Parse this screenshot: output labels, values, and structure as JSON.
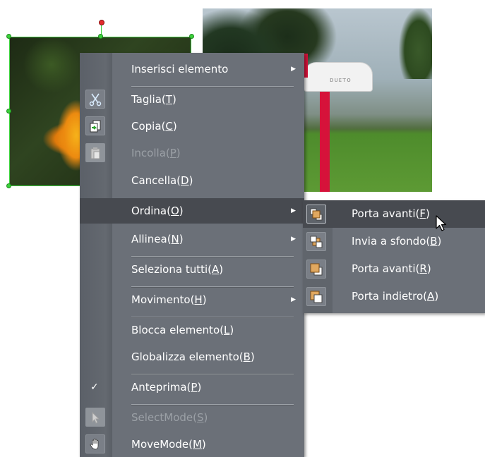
{
  "menu": {
    "items": [
      {
        "pre": "Inserisci elemento",
        "key": "",
        "post": "",
        "submenu": true,
        "disabled": false
      },
      {
        "pre": "Taglia(",
        "key": "T",
        "post": ")",
        "submenu": false,
        "disabled": false,
        "icon": "scissors-icon"
      },
      {
        "pre": "Copia(",
        "key": "C",
        "post": ")",
        "submenu": false,
        "disabled": false,
        "icon": "copy-icon"
      },
      {
        "pre": "Incolla(",
        "key": "P",
        "post": ")",
        "submenu": false,
        "disabled": true,
        "icon": "paste-icon"
      },
      {
        "pre": "Cancella(",
        "key": "D",
        "post": ")",
        "submenu": false,
        "disabled": false
      },
      {
        "pre": "Ordina(",
        "key": "O",
        "post": ")",
        "submenu": true,
        "disabled": false,
        "active": true
      },
      {
        "pre": "Allinea(",
        "key": "N",
        "post": ")",
        "submenu": true,
        "disabled": false
      },
      {
        "pre": "Seleziona tutti(",
        "key": "A",
        "post": ")",
        "submenu": false,
        "disabled": false
      },
      {
        "pre": "Movimento(",
        "key": "H",
        "post": ")",
        "submenu": true,
        "disabled": false
      },
      {
        "pre": "Blocca elemento(",
        "key": "L",
        "post": ")",
        "submenu": false,
        "disabled": false
      },
      {
        "pre": "Globalizza elemento(",
        "key": "B",
        "post": ")",
        "submenu": false,
        "disabled": false
      },
      {
        "pre": "Anteprima(",
        "key": "P",
        "post": ")",
        "submenu": false,
        "disabled": false,
        "checked": true
      },
      {
        "pre": "SelectMode(",
        "key": "S",
        "post": ")",
        "submenu": false,
        "disabled": true,
        "icon": "pointer-icon"
      },
      {
        "pre": "MoveMode(",
        "key": "M",
        "post": ")",
        "submenu": false,
        "disabled": false,
        "icon": "hand-icon"
      }
    ],
    "check_glyph": "✓",
    "arrow_glyph": "▶"
  },
  "submenu": {
    "items": [
      {
        "pre": "Porta avanti(",
        "key": "F",
        "post": ")",
        "icon": "bring-to-front-icon",
        "active": true
      },
      {
        "pre": "Invia a sfondo(",
        "key": "B",
        "post": ")",
        "icon": "send-to-back-icon"
      },
      {
        "pre": "Porta avanti(",
        "key": "R",
        "post": ")",
        "icon": "bring-forward-icon"
      },
      {
        "pre": "Porta indietro(",
        "key": "A",
        "post": ")",
        "icon": "send-backward-icon"
      }
    ]
  },
  "mailbox_text": "ᴅᴜᴇᴛᴏ",
  "colors": {
    "menu_bg": "#6b7078",
    "menu_active": "#474a50",
    "selection": "#3bd13b",
    "rotation_handle": "#e32b2b",
    "mailbox_post": "#d6123a"
  }
}
